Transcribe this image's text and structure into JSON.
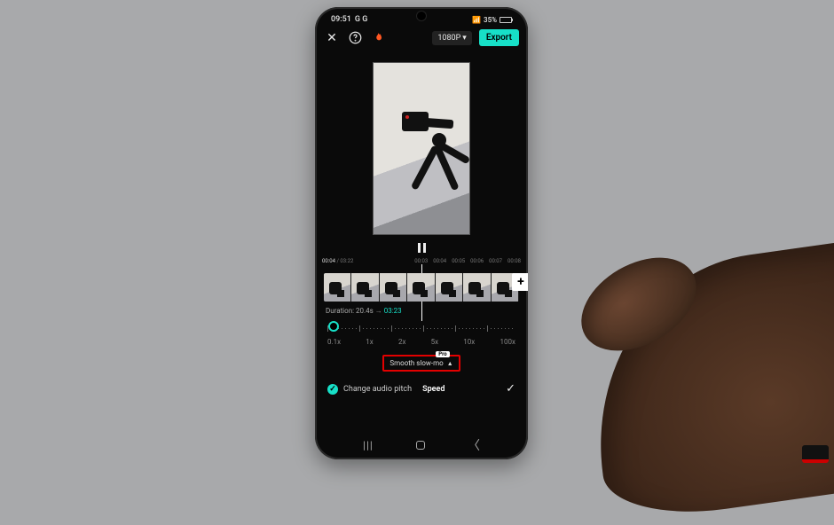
{
  "status": {
    "time": "09:51",
    "indicators": "G G",
    "network": "📶",
    "battery_pct": "35%"
  },
  "topbar": {
    "resolution": "1080P",
    "export": "Export"
  },
  "ruler": {
    "pos": "00:04",
    "total": "03:22",
    "ticks": [
      "00:03",
      "00:04",
      "00:05",
      "00:06",
      "00:07",
      "00:08"
    ]
  },
  "duration": {
    "label": "Duration:",
    "old": "20.4s",
    "new": "03:23"
  },
  "speeds": [
    "0.1x",
    "1x",
    "2x",
    "5x",
    "10x",
    "100x"
  ],
  "smooth": {
    "label": "Smooth slow-mo",
    "badge": "Pro"
  },
  "footer": {
    "pitch": "Change audio pitch",
    "speed": "Speed"
  }
}
